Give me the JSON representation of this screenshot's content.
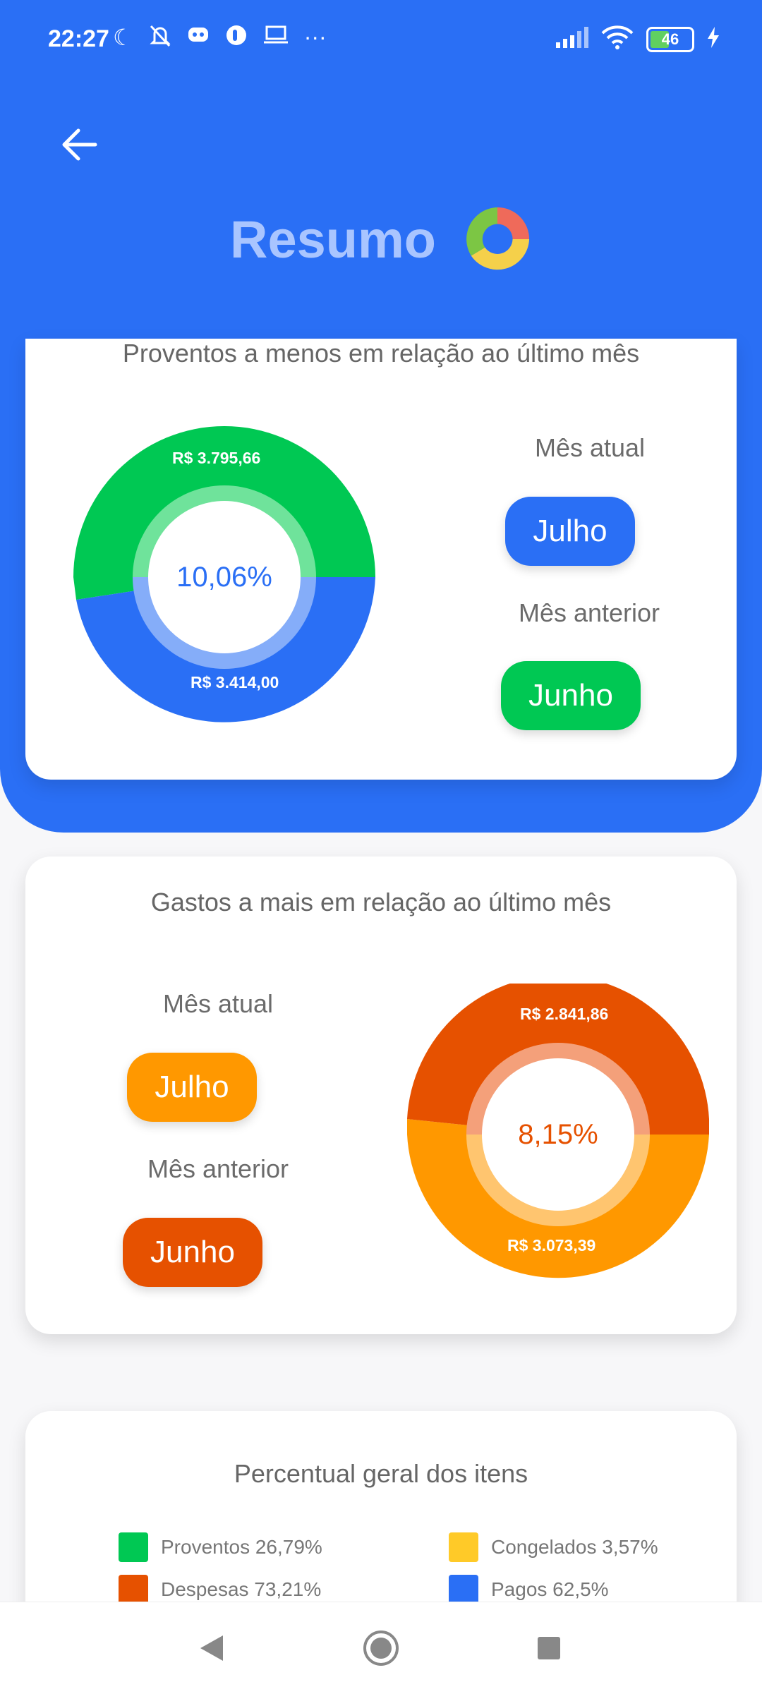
{
  "status_bar": {
    "time": "22:27",
    "battery": "46"
  },
  "header": {
    "title": "Resumo"
  },
  "colors": {
    "blue": "#2a6ff5",
    "green": "#00c853",
    "orange": "#ff9800",
    "deep_orange": "#e65100",
    "yellow": "#ffca28"
  },
  "card_proventos": {
    "title": "Proventos a menos em relação ao último mês",
    "current_label": "Mês atual",
    "current_button": "Julho",
    "previous_label": "Mês anterior",
    "previous_button": "Junho",
    "center_value": "10,06%",
    "segment_top": "R$ 3.795,66",
    "segment_bottom": "R$ 3.414,00"
  },
  "card_gastos": {
    "title": "Gastos a mais em relação ao último mês",
    "current_label": "Mês atual",
    "current_button": "Julho",
    "previous_label": "Mês anterior",
    "previous_button": "Junho",
    "center_value": "8,15%",
    "segment_top": "R$ 2.841,86",
    "segment_bottom": "R$ 3.073,39"
  },
  "card_percentual": {
    "title": "Percentual geral dos itens",
    "legend": [
      {
        "label": "Proventos 26,79%",
        "color": "#00c853"
      },
      {
        "label": "Congelados 3,57%",
        "color": "#ffca28"
      },
      {
        "label": "Despesas 73,21%",
        "color": "#e65100"
      },
      {
        "label": "Pagos 62,5%",
        "color": "#2a6ff5"
      }
    ]
  }
}
